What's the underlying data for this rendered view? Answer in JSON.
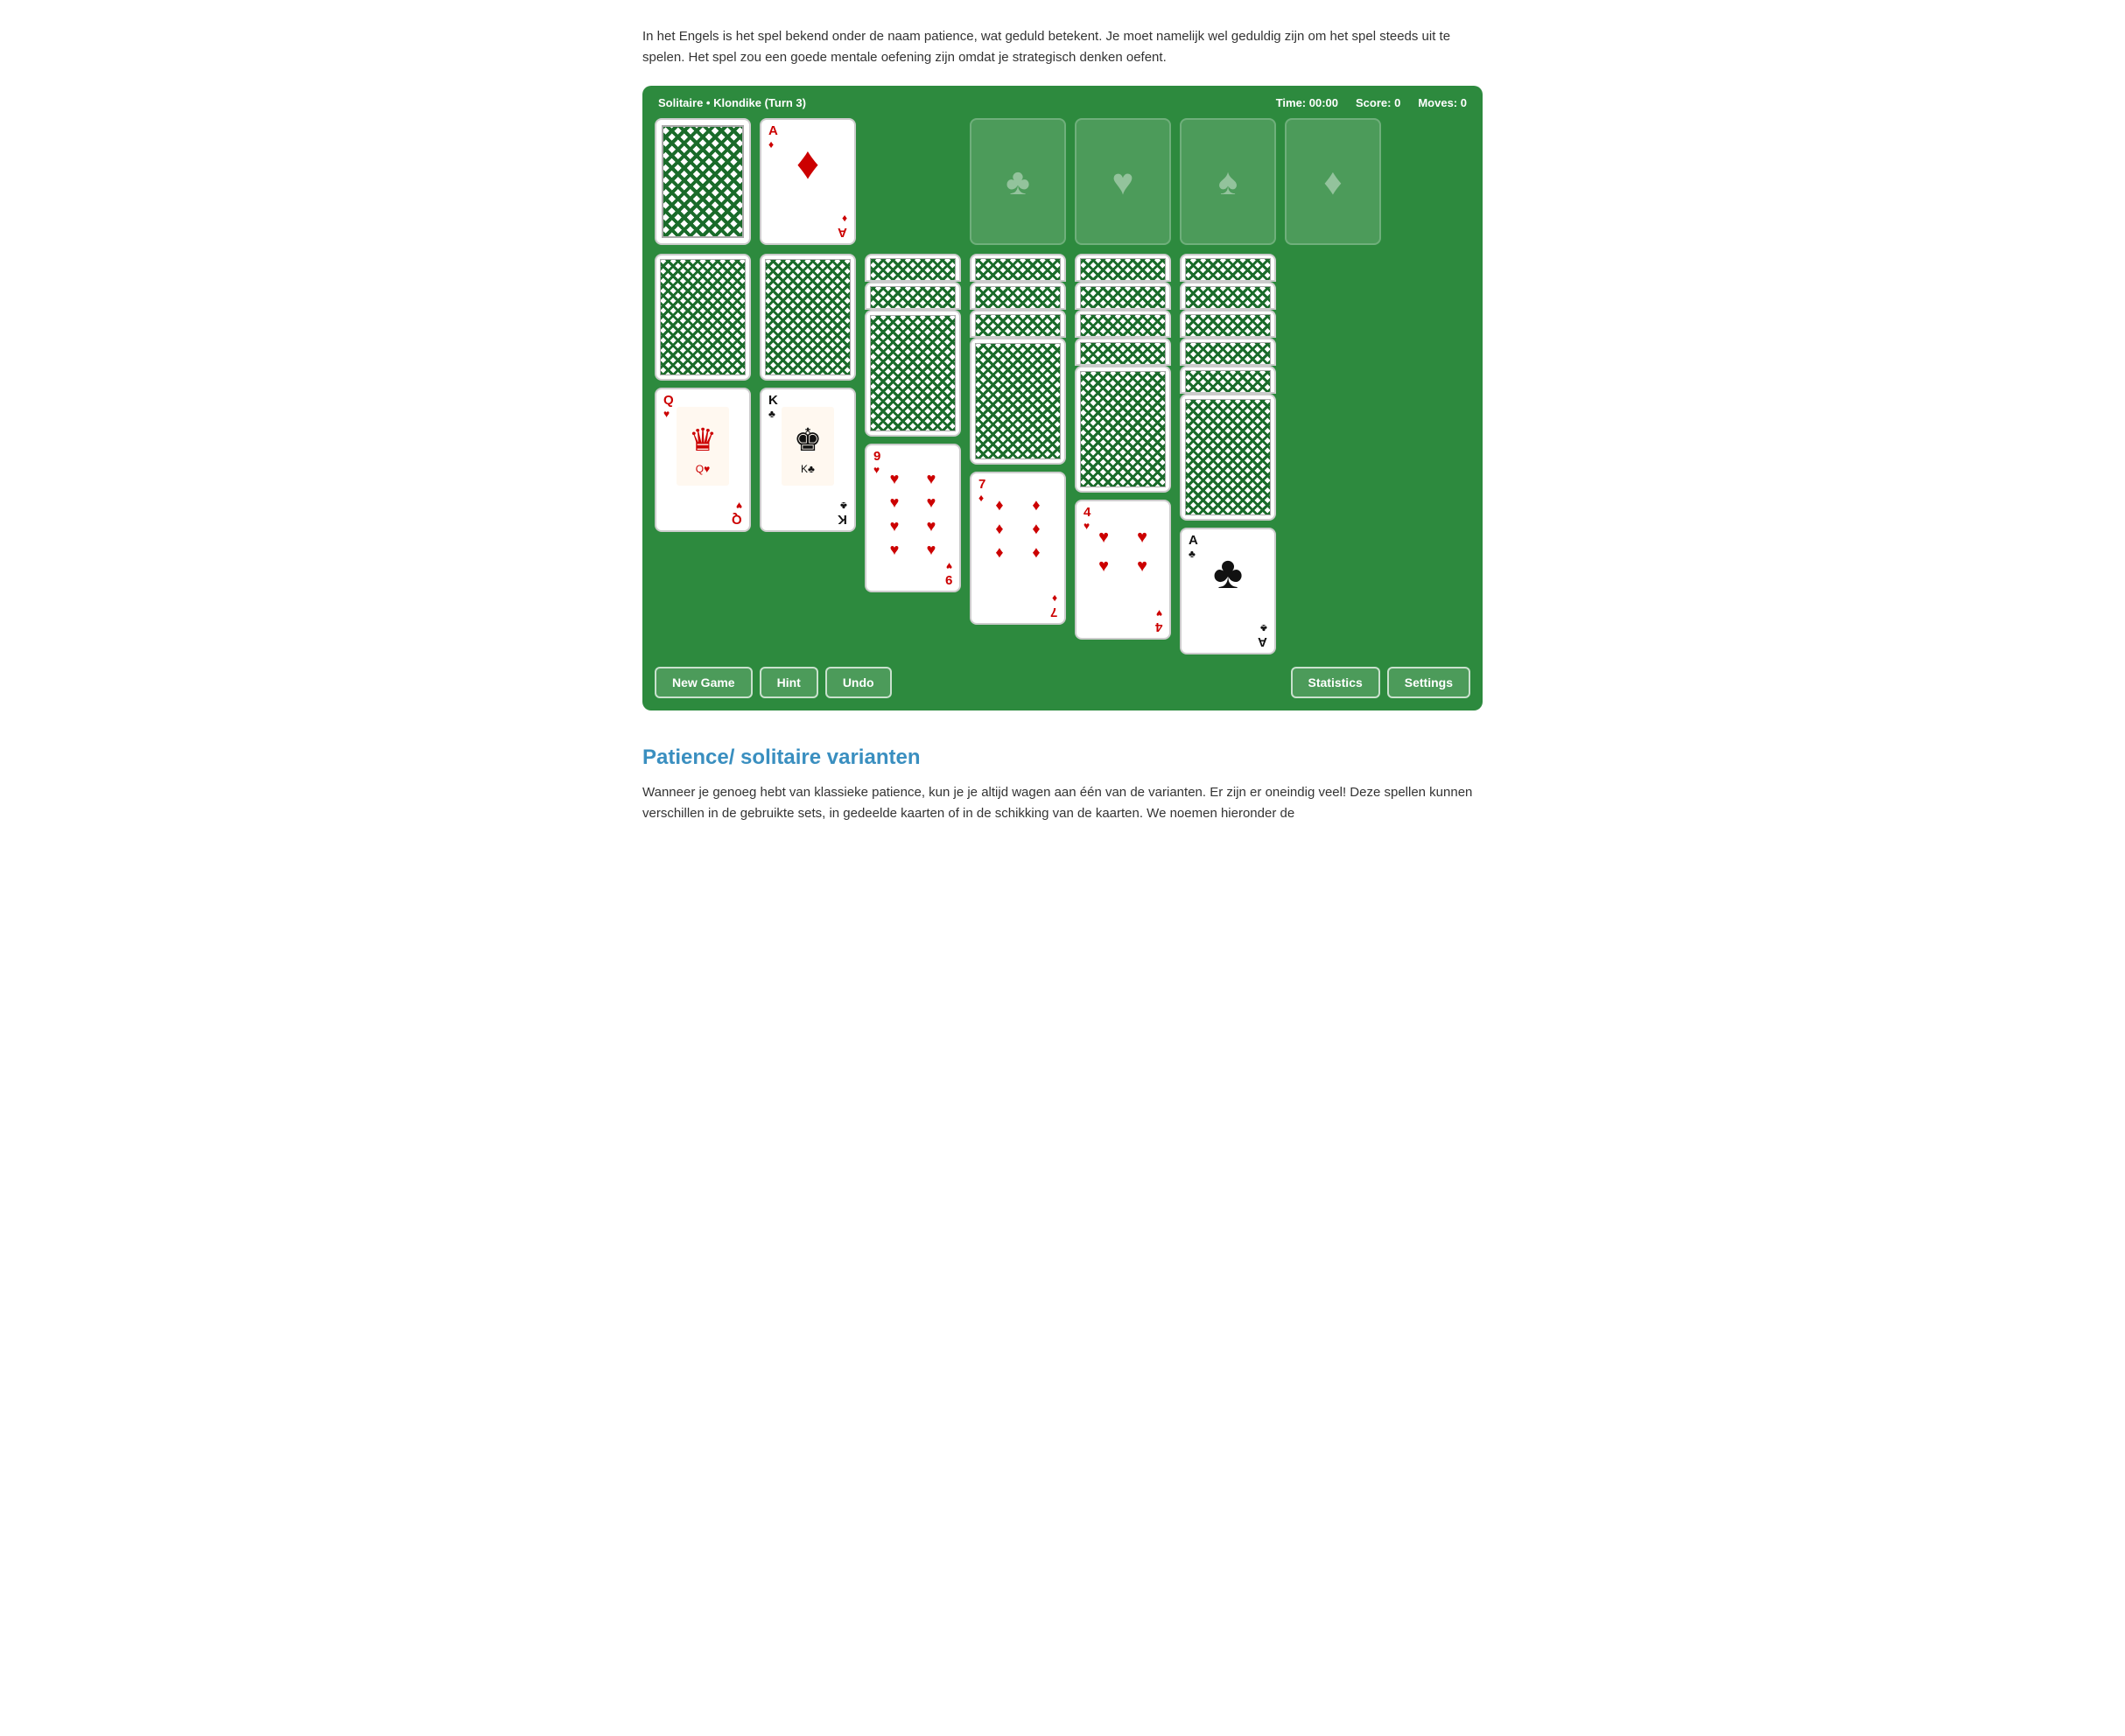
{
  "intro": {
    "text": "In het Engels is het spel bekend onder de naam patience, wat geduld betekent. Je moet namelijk wel geduldig zijn om het spel steeds uit te spelen. Het spel zou een goede mentale oefening zijn omdat je strategisch denken oefent."
  },
  "game": {
    "title": "Solitaire • Klondike (Turn 3)",
    "time_label": "Time:",
    "time_value": "00:00",
    "score_label": "Score:",
    "score_value": "0",
    "moves_label": "Moves:",
    "moves_value": "0",
    "buttons": {
      "new_game": "New Game",
      "hint": "Hint",
      "undo": "Undo",
      "statistics": "Statistics",
      "settings": "Settings"
    },
    "foundation_suits": [
      "♣",
      "♥",
      "♠",
      "♦"
    ]
  },
  "section": {
    "title": "Patience/ solitaire varianten"
  },
  "outro": {
    "text": "Wanneer je genoeg hebt van klassieke patience, kun je je altijd wagen aan één van de varianten. Er zijn er oneindig veel! Deze spellen kunnen verschillen in de gebruikte sets, in gedeelde kaarten of in de schikking van de kaarten. We noemen hieronder de"
  }
}
